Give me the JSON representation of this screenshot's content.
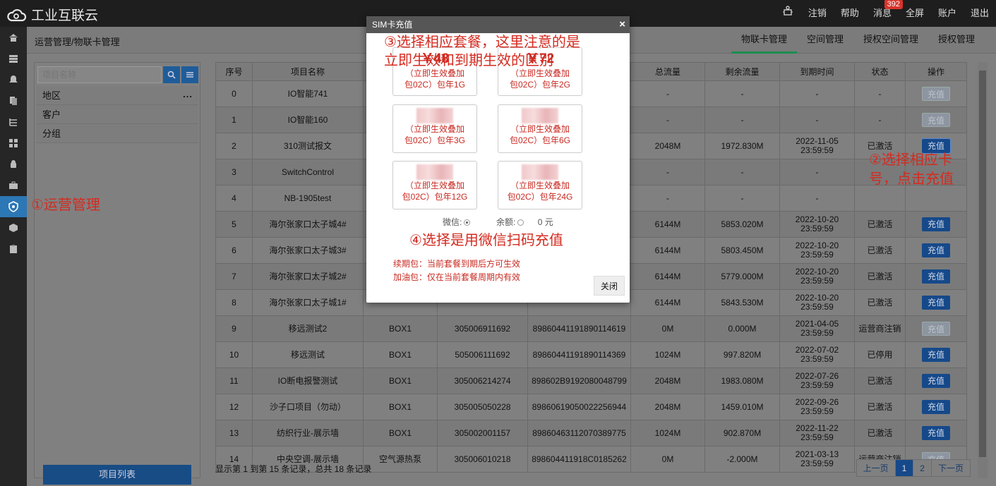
{
  "app": {
    "title": "工业互联云"
  },
  "topnav": {
    "items": [
      "注销",
      "帮助",
      "消息",
      "全屏",
      "账户",
      "退出"
    ],
    "badge": "392"
  },
  "breadcrumb": "运营管理/物联卡管理",
  "subtabs": [
    "物联卡管理",
    "空间管理",
    "授权空间管理",
    "授权管理"
  ],
  "left": {
    "search_placeholder": "项目名称",
    "tree": [
      "地区",
      "客户",
      "分组"
    ],
    "tree_more": "...",
    "project_list": "项目列表"
  },
  "table": {
    "headers": [
      "序号",
      "项目名称",
      "",
      "",
      "",
      "总流量",
      "剩余流量",
      "到期时间",
      "状态",
      "操作"
    ],
    "rows": [
      {
        "no": "0",
        "name": "IO智能741",
        "type": "",
        "sn": "",
        "iccid": "",
        "total": "-",
        "remain": "-",
        "expire": "-",
        "expire2": "",
        "status": "-",
        "op": "充值",
        "opstate": "off"
      },
      {
        "no": "1",
        "name": "IO智能160",
        "type": "",
        "sn": "",
        "iccid": "",
        "total": "-",
        "remain": "-",
        "expire": "-",
        "expire2": "",
        "status": "-",
        "op": "充值",
        "opstate": "off"
      },
      {
        "no": "2",
        "name": "310测试报文",
        "type": "",
        "sn": "",
        "iccid": "",
        "total": "2048M",
        "remain": "1972.830M",
        "expire": "2022-11-05",
        "expire2": "23:59:59",
        "status": "已激活",
        "op": "充值",
        "opstate": "focus"
      },
      {
        "no": "3",
        "name": "SwitchControl",
        "type": "",
        "sn": "",
        "iccid": "",
        "total": "-",
        "remain": "-",
        "expire": "-",
        "expire2": "",
        "status": "",
        "op": "",
        "opstate": "none"
      },
      {
        "no": "4",
        "name": "NB-1905test",
        "type": "",
        "sn": "",
        "iccid": "",
        "total": "-",
        "remain": "-",
        "expire": "-",
        "expire2": "",
        "status": "",
        "op": "",
        "opstate": "none"
      },
      {
        "no": "5",
        "name": "海尔张家口太子城4#",
        "type": "",
        "sn": "",
        "iccid": "",
        "total": "6144M",
        "remain": "5853.020M",
        "expire": "2022-10-20",
        "expire2": "23:59:59",
        "status": "已激活",
        "op": "充值",
        "opstate": "on"
      },
      {
        "no": "6",
        "name": "海尔张家口太子城3#",
        "type": "",
        "sn": "",
        "iccid": "",
        "total": "6144M",
        "remain": "5803.450M",
        "expire": "2022-10-20",
        "expire2": "23:59:59",
        "status": "已激活",
        "op": "充值",
        "opstate": "on"
      },
      {
        "no": "7",
        "name": "海尔张家口太子城2#",
        "type": "",
        "sn": "",
        "iccid": "",
        "total": "6144M",
        "remain": "5779.000M",
        "expire": "2022-10-20",
        "expire2": "23:59:59",
        "status": "已激活",
        "op": "充值",
        "opstate": "on"
      },
      {
        "no": "8",
        "name": "海尔张家口太子城1#",
        "type": "",
        "sn": "",
        "iccid": "",
        "total": "6144M",
        "remain": "5843.530M",
        "expire": "2022-10-20",
        "expire2": "23:59:59",
        "status": "已激活",
        "op": "充值",
        "opstate": "on"
      },
      {
        "no": "9",
        "name": "移远测试2",
        "type": "BOX1",
        "sn": "305006911692",
        "iccid": "89860441191890114619",
        "total": "0M",
        "remain": "0.000M",
        "expire": "2021-04-05",
        "expire2": "23:59:59",
        "status": "运营商注销",
        "op": "充值",
        "opstate": "off"
      },
      {
        "no": "10",
        "name": "移远测试",
        "type": "BOX1",
        "sn": "505006111692",
        "iccid": "89860441191890114369",
        "total": "1024M",
        "remain": "997.820M",
        "expire": "2022-07-02",
        "expire2": "23:59:59",
        "status": "已停用",
        "op": "充值",
        "opstate": "on"
      },
      {
        "no": "11",
        "name": "IO断电报警测试",
        "type": "BOX1",
        "sn": "305006214274",
        "iccid": "898602B9192080048799",
        "total": "2048M",
        "remain": "1983.080M",
        "expire": "2022-07-26",
        "expire2": "23:59:59",
        "status": "已激活",
        "op": "充值",
        "opstate": "on"
      },
      {
        "no": "12",
        "name": "沙子口项目（勿动）",
        "type": "BOX1",
        "sn": "305005050228",
        "iccid": "89860619050022256944",
        "total": "2048M",
        "remain": "1459.010M",
        "expire": "2022-09-26",
        "expire2": "23:59:59",
        "status": "已激活",
        "op": "充值",
        "opstate": "on"
      },
      {
        "no": "13",
        "name": "纺织行业-展示墙",
        "type": "BOX1",
        "sn": "305002001157",
        "iccid": "89860463112070389775",
        "total": "1024M",
        "remain": "902.870M",
        "expire": "2022-11-22",
        "expire2": "23:59:59",
        "status": "已激活",
        "op": "充值",
        "opstate": "on"
      },
      {
        "no": "14",
        "name": "中央空调-展示墙",
        "type": "空气源热泵",
        "sn": "305006010218",
        "iccid": "898604411918C0185262",
        "total": "0M",
        "remain": "-2.000M",
        "expire": "2021-03-13",
        "expire2": "23:59:59",
        "status": "运营商注销",
        "op": "充值",
        "opstate": "off"
      }
    ]
  },
  "footer": "显示第 1 到第 15 条记录，总共 18 条记录",
  "pager": {
    "prev": "上一页",
    "pages": [
      "1",
      "2"
    ],
    "next": "下一页"
  },
  "modal": {
    "title": "SIM卡充值",
    "close_x": "×",
    "packages": [
      {
        "price": "￥48",
        "desc1": "（立即生效叠加",
        "desc2": "包02C）包年1G"
      },
      {
        "price": "￥72",
        "desc1": "（立即生效叠加",
        "desc2": "包02C）包年2G"
      },
      {
        "price": "",
        "desc1": "（立即生效叠加",
        "desc2": "包02C）包年3G"
      },
      {
        "price": "",
        "desc1": "（立即生效叠加",
        "desc2": "包02C）包年6G"
      },
      {
        "price": "",
        "desc1": "（立即生效叠加",
        "desc2": "包02C）包年12G"
      },
      {
        "price": "",
        "desc1": "（立即生效叠加",
        "desc2": "包02C）包年24G"
      }
    ],
    "pay_wechat": "微信:",
    "pay_balance": "余额:",
    "balance_value": "0 元",
    "note1": "续期包：当前套餐到期后方可生效",
    "note2": "加油包：仅在当前套餐周期内有效",
    "close_btn": "关闭"
  },
  "annotations": {
    "a1": "①运营管理",
    "a2_line1": "②选择相应卡",
    "a2_line2": "号，点击充值",
    "a3_line1": "③选择相应套餐，这里注意的是",
    "a3_line2": "立即生效和到期生效的区别",
    "a4": "④选择是用微信扫码充值"
  },
  "colors": {
    "accent": "#16498a",
    "annotation": "#d42b20",
    "active_tab_underline": "#1b8e4e"
  }
}
